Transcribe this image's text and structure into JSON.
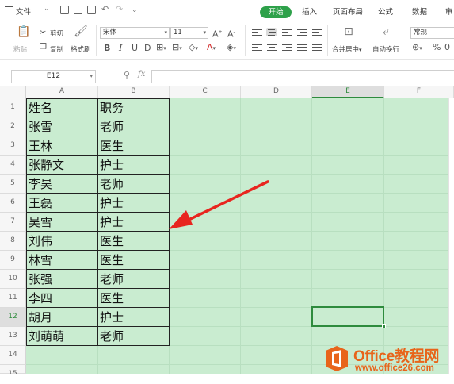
{
  "menubar": {
    "file_label": "文件",
    "tabs": [
      {
        "label": "开始",
        "active": true
      },
      {
        "label": "插入"
      },
      {
        "label": "页面布局"
      },
      {
        "label": "公式"
      },
      {
        "label": "数据"
      },
      {
        "label": "审"
      }
    ]
  },
  "ribbon": {
    "paste_label": "粘贴",
    "cut_label": "剪切",
    "copy_label": "复制",
    "format_painter_label": "格式刷",
    "font_name": "宋体",
    "font_size": "11",
    "merge_center_label": "合并居中",
    "wrap_text_label": "自动换行",
    "number_format": "常规",
    "percent_symbol": "%"
  },
  "formula_bar": {
    "cell_ref": "E12",
    "fx_label": "fx",
    "formula": ""
  },
  "grid": {
    "columns": [
      "A",
      "B",
      "C",
      "D",
      "E",
      "F"
    ],
    "selected_column": "E",
    "rows": [
      "1",
      "2",
      "3",
      "4",
      "5",
      "6",
      "7",
      "8",
      "9",
      "10",
      "11",
      "12",
      "13",
      "14",
      "15"
    ],
    "selected_row": "12",
    "table": [
      [
        "姓名",
        "职务"
      ],
      [
        "张雪",
        "老师"
      ],
      [
        "王林",
        "医生"
      ],
      [
        "张静文",
        "护士"
      ],
      [
        "李昊",
        "老师"
      ],
      [
        "王磊",
        "护士"
      ],
      [
        "吴雪",
        "护士"
      ],
      [
        "刘伟",
        "医生"
      ],
      [
        "林雪",
        "医生"
      ],
      [
        "张强",
        "老师"
      ],
      [
        "李四",
        "医生"
      ],
      [
        "胡月",
        "护士"
      ],
      [
        "刘萌萌",
        "老师"
      ]
    ],
    "cell_background": "#c9ecd0"
  },
  "annotation": {
    "arrow_color": "#e8251f"
  },
  "watermark": {
    "title": "Office教程网",
    "url": "www.office26.com",
    "color": "#e8641a"
  }
}
